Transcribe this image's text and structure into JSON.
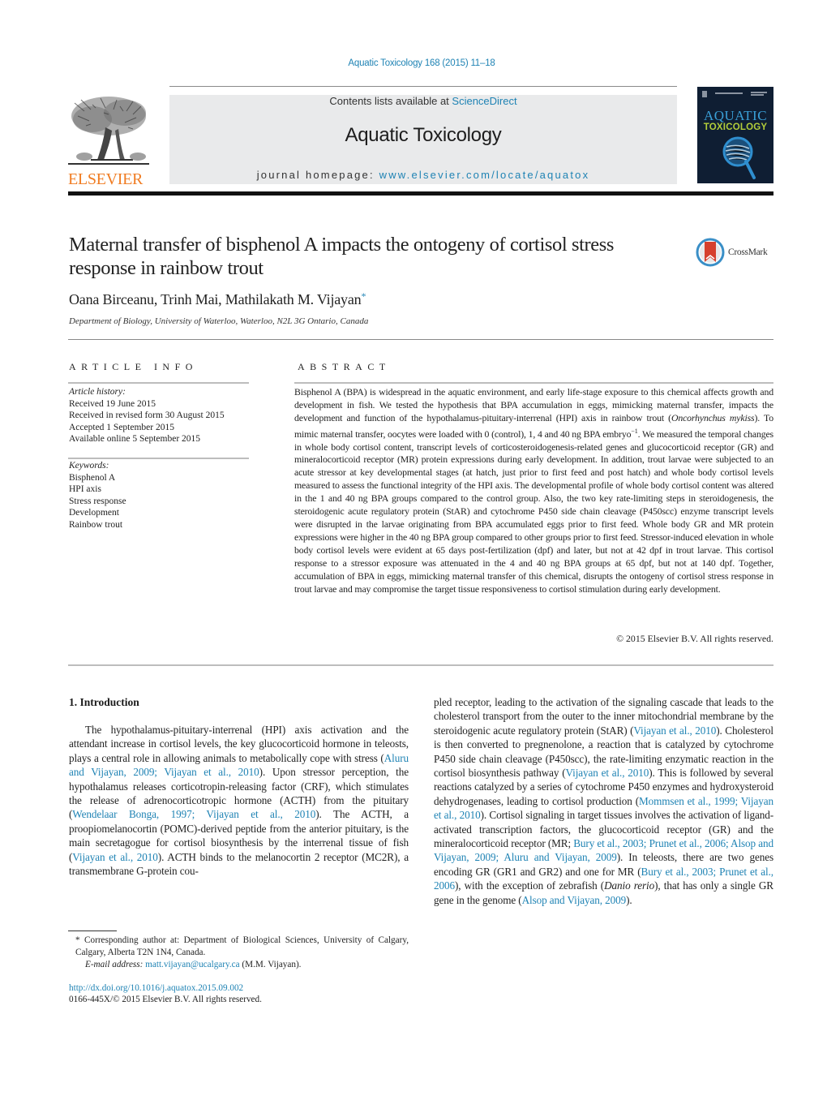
{
  "journal_header": {
    "citation": "Aquatic Toxicology 168 (2015) 11–18",
    "contents_prefix": "Contents lists available at ",
    "contents_link": "ScienceDirect",
    "journal_title": "Aquatic Toxicology",
    "homepage_prefix": "journal homepage: ",
    "homepage_link": "www.elsevier.com/locate/aquatox",
    "publisher_logo_text": "ELSEVIER",
    "cover": {
      "line1": "AQUATIC",
      "line2": "TOXICOLOGY"
    },
    "colors": {
      "link": "#1f83b4",
      "elsevier_orange": "#f07c22",
      "cover_bg": "#0f1e33",
      "cover_green": "#b2cd3a"
    }
  },
  "article": {
    "title": "Maternal transfer of bisphenol A impacts the ontogeny of cortisol stress response in rainbow trout",
    "crossmark_label": "CrossMark",
    "authors": "Oana Birceanu, Trinh Mai, Mathilakath M. Vijayan",
    "corresponding_marker": "*",
    "affiliation": "Department of Biology, University of Waterloo, Waterloo, N2L 3G Ontario, Canada"
  },
  "article_info": {
    "label": "ARTICLE INFO",
    "history_heading": "Article history:",
    "history": [
      "Received 19 June 2015",
      "Received in revised form 30 August 2015",
      "Accepted 1 September 2015",
      "Available online 5 September 2015"
    ],
    "keywords_heading": "Keywords:",
    "keywords": [
      "Bisphenol A",
      "HPI axis",
      "Stress response",
      "Development",
      "Rainbow trout"
    ]
  },
  "abstract": {
    "label": "ABSTRACT",
    "p1": "Bisphenol A (BPA) is widespread in the aquatic environment, and early life-stage exposure to this chemical affects growth and development in fish. We tested the hypothesis that BPA accumulation in eggs, mimicking maternal transfer, impacts the development and function of the hypothalamus-pituitary-interrenal (HPI) axis in rainbow trout (",
    "species": "Oncorhynchus mykiss",
    "p2": "). To mimic maternal transfer, oocytes were loaded with 0 (control), 1, 4 and 40 ng BPA embryo",
    "superscript": "−1",
    "p3": ". We measured the temporal changes in whole body cortisol content, transcript levels of corticosteroidogenesis-related genes and glucocorticoid receptor (GR) and mineralocorticoid receptor (MR) protein expressions during early development. In addition, trout larvae were subjected to an acute stressor at key developmental stages (at hatch, just prior to first feed and post hatch) and whole body cortisol levels measured to assess the functional integrity of the HPI axis. The developmental profile of whole body cortisol content was altered in the 1 and 40 ng BPA groups compared to the control group. Also, the two key rate-limiting steps in steroidogenesis, the steroidogenic acute regulatory protein (StAR) and cytochrome P450 side chain cleavage (P450scc) enzyme transcript levels were disrupted in the larvae originating from BPA accumulated eggs prior to first feed. Whole body GR and MR protein expressions were higher in the 40 ng BPA group compared to other groups prior to first feed. Stressor-induced elevation in whole body cortisol levels were evident at 65 days post-fertilization (dpf) and later, but not at 42 dpf in trout larvae. This cortisol response to a stressor exposure was attenuated in the 4 and 40 ng BPA groups at 65 dpf, but not at 140 dpf. Together, accumulation of BPA in eggs, mimicking maternal transfer of this chemical, disrupts the ontogeny of cortisol stress response in trout larvae and may compromise the target tissue responsiveness to cortisol stimulation during early development.",
    "copyright": "© 2015 Elsevier B.V. All rights reserved."
  },
  "introduction": {
    "heading": "1.  Introduction",
    "left_column": [
      {
        "t": "The hypothalamus-pituitary-interrenal (HPI) axis activation and the attendant increase in cortisol levels, the key glucocorticoid hormone in teleosts, plays a central role in allowing animals to metabolically cope with stress ("
      },
      {
        "t": "Aluru and Vijayan, 2009; Vijayan et al., 2010",
        "link": true
      },
      {
        "t": "). Upon stressor perception, the hypothalamus releases corticotropin-releasing factor (CRF), which stimulates the release of adrenocorticotropic hormone (ACTH) from the pituitary ("
      },
      {
        "t": "Wendelaar Bonga, 1997; Vijayan et al., 2010",
        "link": true
      },
      {
        "t": "). The ACTH, a proopiomelanocortin (POMC)-derived peptide from the anterior pituitary, is the main secretagogue for cortisol biosynthesis by the interrenal tissue of fish ("
      },
      {
        "t": "Vijayan et al., 2010",
        "link": true
      },
      {
        "t": "). ACTH binds to the melanocortin 2 receptor (MC2R), a transmembrane G-protein cou-"
      }
    ],
    "right_column": [
      {
        "t": "pled receptor, leading to the activation of the signaling cascade that leads to the cholesterol transport from the outer to the inner mitochondrial membrane by the steroidogenic acute regulatory protein (StAR) ("
      },
      {
        "t": "Vijayan et al., 2010",
        "link": true
      },
      {
        "t": "). Cholesterol is then converted to pregnenolone, a reaction that is catalyzed by cytochrome P450 side chain cleavage (P450scc), the rate-limiting enzymatic reaction in the cortisol biosynthesis pathway ("
      },
      {
        "t": "Vijayan et al., 2010",
        "link": true
      },
      {
        "t": "). This is followed by several reactions catalyzed by a series of cytochrome P450 enzymes and hydroxysteroid dehydrogenases, leading to cortisol production ("
      },
      {
        "t": "Mommsen et al., 1999; Vijayan et al., 2010",
        "link": true
      },
      {
        "t": "). Cortisol signaling in target tissues involves the activation of ligand-activated transcription factors, the glucocorticoid receptor (GR) and the mineralocorticoid receptor (MR; "
      },
      {
        "t": "Bury et al., 2003; Prunet et al., 2006; Alsop and Vijayan, 2009; Aluru and Vijayan, 2009",
        "link": true
      },
      {
        "t": "). In teleosts, there are two genes encoding GR (GR1 and GR2) and one for MR ("
      },
      {
        "t": "Bury et al., 2003; Prunet et al., 2006",
        "link": true
      },
      {
        "t": "), with the exception of zebrafish ("
      },
      {
        "t": "Danio rerio",
        "italic": true
      },
      {
        "t": "), that has only a single GR gene in the genome ("
      },
      {
        "t": "Alsop and Vijayan, 2009",
        "link": true
      },
      {
        "t": ")."
      }
    ]
  },
  "footnote": {
    "marker": "*",
    "corresponding": "Corresponding author at: Department of Biological Sciences, University of Calgary, Calgary, Alberta T2N 1N4, Canada.",
    "email_label": "E-mail address: ",
    "email": "matt.vijayan@ucalgary.ca",
    "email_suffix": " (M.M. Vijayan).",
    "doi": "http://dx.doi.org/10.1016/j.aquatox.2015.09.002",
    "issn": "0166-445X/© 2015 Elsevier B.V. All rights reserved."
  }
}
